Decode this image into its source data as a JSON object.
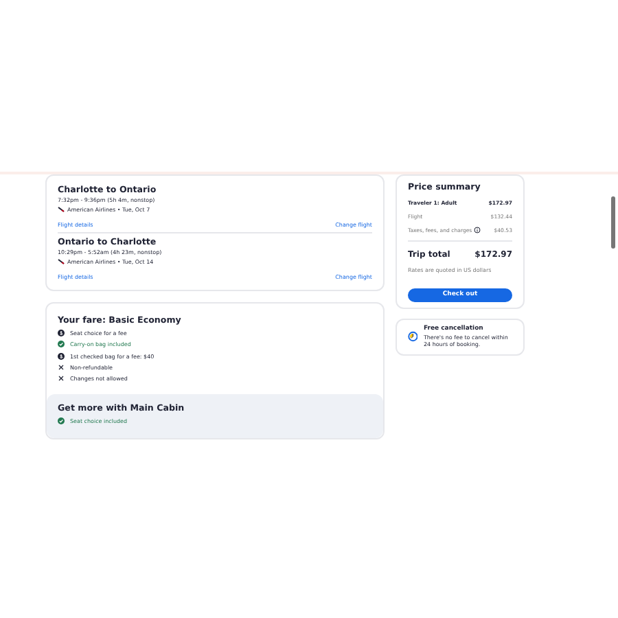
{
  "flights": [
    {
      "title": "Charlotte to Ontario",
      "times": "7:32pm - 9:36pm (5h 4m, nonstop)",
      "airline": "American Airlines • Tue, Oct 7",
      "details_link": "Flight details",
      "change_link": "Change flight"
    },
    {
      "title": "Ontario to Charlotte",
      "times": "10:29pm - 5:52am (4h 23m, nonstop)",
      "airline": "American Airlines • Tue, Oct 14",
      "details_link": "Flight details",
      "change_link": "Change flight"
    }
  ],
  "fare": {
    "title": "Your fare: Basic Economy",
    "features": [
      {
        "kind": "fee",
        "text": "Seat choice for a fee"
      },
      {
        "kind": "included",
        "text": "Carry-on bag included"
      },
      {
        "kind": "fee",
        "text": "1st checked bag for a fee: $40"
      },
      {
        "kind": "no",
        "text": "Non-refundable"
      },
      {
        "kind": "no",
        "text": "Changes not allowed"
      }
    ]
  },
  "upsell": {
    "title": "Get more with Main Cabin",
    "features": [
      {
        "kind": "included",
        "text": "Seat choice included"
      }
    ]
  },
  "price_summary": {
    "title": "Price summary",
    "traveler": {
      "label": "Traveler 1: Adult",
      "amount": "$172.97"
    },
    "lines": [
      {
        "label": "Flight",
        "amount": "$132.44",
        "info": false
      },
      {
        "label": "Taxes, fees, and charges",
        "amount": "$40.53",
        "info": true
      }
    ],
    "total_label": "Trip total",
    "total": "$172.97",
    "note": "Rates are quoted in US dollars",
    "checkout": "Check out"
  },
  "cancellation": {
    "title": "Free cancellation",
    "text": "There's no fee to cancel within 24 hours of booking."
  }
}
